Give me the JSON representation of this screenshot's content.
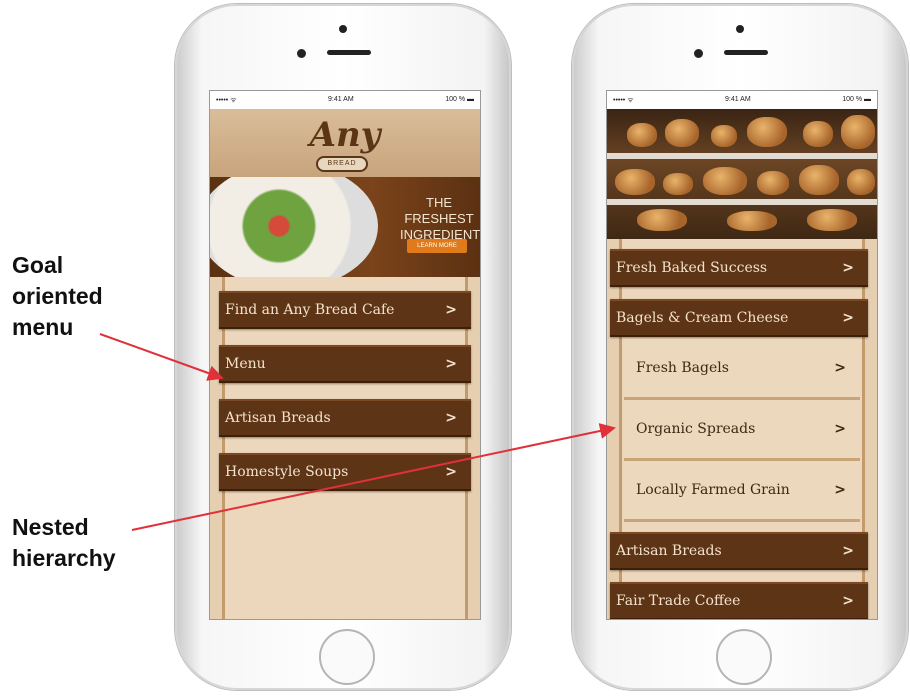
{
  "annotations": {
    "goal": "Goal\noriented\nmenu",
    "nested": "Nested\nhierarchy"
  },
  "status_bar": {
    "signal": "••••• ᯤ",
    "time": "9:41 AM",
    "battery": "100 % ▬"
  },
  "colors": {
    "menu_bg": "#5e3416",
    "menu_text": "#f3e3cc",
    "content_bg": "#ecd7bc",
    "arrow": "#e0303a"
  },
  "left_screen": {
    "logo": {
      "script": "Any",
      "badge": "BREAD"
    },
    "banner": {
      "line1": "THE FRESHEST",
      "line2": "INGREDIENTS",
      "button": "LEARN MORE"
    },
    "menu_items": [
      {
        "label": "Find an Any Bread Cafe",
        "icon": "chevron-right"
      },
      {
        "label": "Menu",
        "icon": "chevron-right"
      },
      {
        "label": "Artisan Breads",
        "icon": "chevron-right"
      },
      {
        "label": "Homestyle Soups",
        "icon": "chevron-right"
      }
    ]
  },
  "right_screen": {
    "top_items": [
      {
        "label": "Fresh Baked Success"
      },
      {
        "label": "Bagels & Cream Cheese"
      }
    ],
    "sub_items": [
      {
        "label": "Fresh Bagels"
      },
      {
        "label": "Organic Spreads"
      },
      {
        "label": "Locally Farmed Grain"
      }
    ],
    "bottom_items": [
      {
        "label": "Artisan Breads"
      },
      {
        "label": "Fair Trade Coffee"
      }
    ],
    "chevron": ">"
  }
}
